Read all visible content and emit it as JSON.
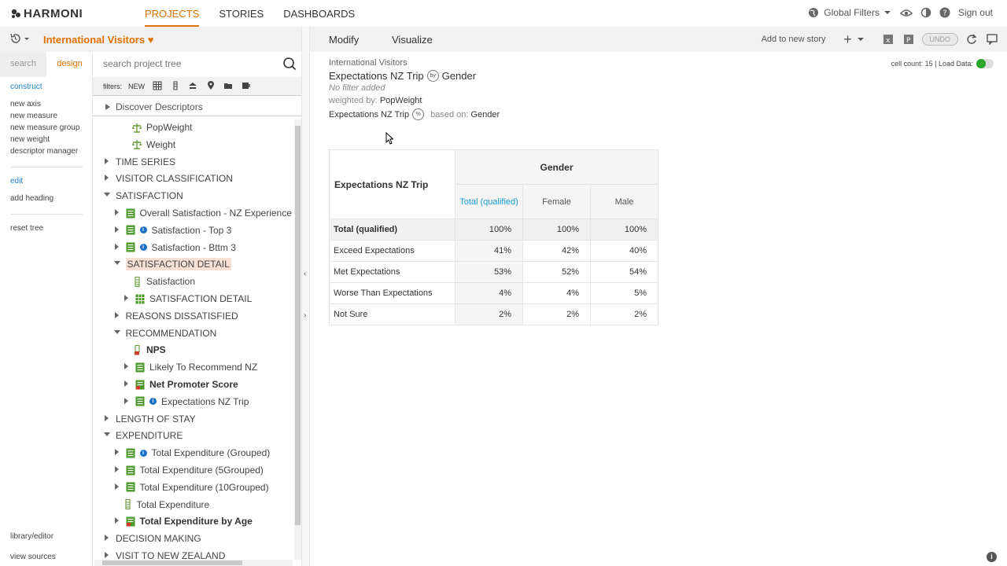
{
  "brand": "HARMONI",
  "nav": [
    "PROJECTS",
    "STORIES",
    "DASHBOARDS"
  ],
  "topbar": {
    "global_filters": "Global Filters",
    "sign_out": "Sign out"
  },
  "project": {
    "title": "International Visitors"
  },
  "left_tabs": {
    "search": "search",
    "design": "design"
  },
  "construct": {
    "head": "construct",
    "items": [
      "new axis",
      "new measure",
      "new measure group",
      "new weight",
      "descriptor manager"
    ]
  },
  "edit": {
    "head": "edit",
    "items": [
      "add heading"
    ]
  },
  "reset": "reset tree",
  "bottom_links": {
    "library": "library/editor",
    "sources": "view sources"
  },
  "tree_search": {
    "placeholder": "search project tree"
  },
  "filters": {
    "label": "filters:",
    "new": "NEW"
  },
  "discover": "Discover Descriptors",
  "tree": [
    {
      "label": "PopWeight",
      "indent": 2,
      "icon": "weight-icon",
      "tri": ""
    },
    {
      "label": "Weight",
      "indent": 2,
      "icon": "weight-icon",
      "tri": ""
    },
    {
      "label": "TIME SERIES",
      "indent": 0,
      "icon": "",
      "tri": "right"
    },
    {
      "label": "VISITOR CLASSIFICATION",
      "indent": 0,
      "icon": "",
      "tri": "right"
    },
    {
      "label": "SATISFACTION",
      "indent": 0,
      "icon": "",
      "tri": "down"
    },
    {
      "label": "Overall Satisfaction - NZ Experience",
      "indent": 1,
      "icon": "list-icon",
      "tri": "right"
    },
    {
      "label": "Satisfaction - Top 3",
      "indent": 1,
      "icon": "list-icon",
      "tri": "right",
      "info": true
    },
    {
      "label": "Satisfaction - Bttm 3",
      "indent": 1,
      "icon": "list-icon",
      "tri": "right",
      "info": true
    },
    {
      "label": "SATISFACTION DETAIL",
      "indent": 1,
      "icon": "",
      "tri": "down",
      "sel": true
    },
    {
      "label": "Satisfaction",
      "indent": 2,
      "icon": "bar-icon",
      "tri": ""
    },
    {
      "label": "SATISFACTION DETAIL",
      "indent": 2,
      "icon": "grid-icon",
      "tri": "right"
    },
    {
      "label": "REASONS DISSATISFIED",
      "indent": 1,
      "icon": "",
      "tri": "right"
    },
    {
      "label": "RECOMMENDATION",
      "indent": 1,
      "icon": "",
      "tri": "down"
    },
    {
      "label": "NPS",
      "indent": 2,
      "icon": "nps-icon",
      "tri": "",
      "bold": true
    },
    {
      "label": "Likely To Recommend NZ",
      "indent": 2,
      "icon": "list-icon",
      "tri": "right"
    },
    {
      "label": "Net Promoter Score",
      "indent": 2,
      "icon": "list-red-icon",
      "tri": "right",
      "bold": true
    },
    {
      "label": "Expectations NZ Trip",
      "indent": 2,
      "icon": "list-icon",
      "tri": "right",
      "info": true
    },
    {
      "label": "LENGTH OF STAY",
      "indent": 0,
      "icon": "",
      "tri": "right"
    },
    {
      "label": "EXPENDITURE",
      "indent": 0,
      "icon": "",
      "tri": "down"
    },
    {
      "label": "Total Expenditure (Grouped)",
      "indent": 1,
      "icon": "list-icon",
      "tri": "right",
      "info": true
    },
    {
      "label": "Total Expenditure (5Grouped)",
      "indent": 1,
      "icon": "list-icon",
      "tri": "right"
    },
    {
      "label": "Total Expenditure (10Grouped)",
      "indent": 1,
      "icon": "list-icon",
      "tri": "right"
    },
    {
      "label": "Total Expenditure",
      "indent": 1,
      "icon": "bar-icon",
      "tri": ""
    },
    {
      "label": "Total Expenditure by Age",
      "indent": 1,
      "icon": "list-red-icon",
      "tri": "right",
      "bold": true
    },
    {
      "label": "DECISION MAKING",
      "indent": 0,
      "icon": "",
      "tri": "right"
    },
    {
      "label": "VISIT TO NEW ZEALAND",
      "indent": 0,
      "icon": "",
      "tri": "right"
    }
  ],
  "main_tabs": {
    "modify": "Modify",
    "visualize": "Visualize"
  },
  "toolbar": {
    "add_story": "Add to new story",
    "undo": "UNDO"
  },
  "meta": {
    "source": "International Visitors",
    "title_row": "Expectations NZ Trip",
    "title_col": "Gender",
    "by_badge": "by",
    "pct_badge": "%",
    "no_filter": "No filter added",
    "weighted_label": "weighted by:",
    "weighted_value": "PopWeight",
    "base_row": "Expectations NZ Trip",
    "based_on_label": "based on:",
    "based_on_value": "Gender",
    "cell_count": "cell count: 15",
    "load_data": "| Load Data:"
  },
  "table": {
    "row_header": "Expectations NZ Trip",
    "group_header": "Gender",
    "columns": [
      "Total (qualified)",
      "Female",
      "Male"
    ],
    "rows": [
      {
        "label": "Total (qualified)",
        "values": [
          "100%",
          "100%",
          "100%"
        ]
      },
      {
        "label": "Exceed Expectations",
        "values": [
          "41%",
          "42%",
          "40%"
        ]
      },
      {
        "label": "Met Expectations",
        "values": [
          "53%",
          "52%",
          "54%"
        ]
      },
      {
        "label": "Worse Than Expectations",
        "values": [
          "4%",
          "4%",
          "5%"
        ]
      },
      {
        "label": "Not Sure",
        "values": [
          "2%",
          "2%",
          "2%"
        ]
      }
    ]
  },
  "colors": {
    "accent": "#e07000",
    "link": "#1a7fc6",
    "selected": "#f6e0d4"
  }
}
